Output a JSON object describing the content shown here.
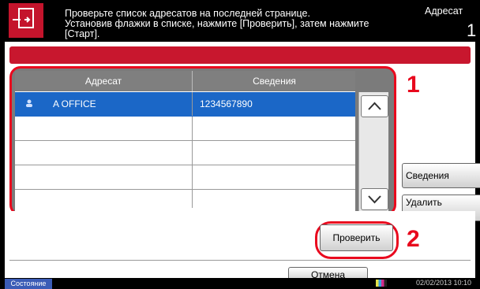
{
  "header": {
    "message_line1": "Проверьте список адресатов на последней странице.",
    "message_line2": "Установив флажки в списке, нажмите [Проверить], затем нажмите",
    "message_line3": "[Старт].",
    "dest_label": "Адресат",
    "dest_count": "1"
  },
  "table": {
    "col_dest": "Адресат",
    "col_info": "Сведения",
    "rows": [
      {
        "name": "A OFFICE",
        "detail": "1234567890"
      },
      {
        "name": "",
        "detail": ""
      },
      {
        "name": "",
        "detail": ""
      },
      {
        "name": "",
        "detail": ""
      },
      {
        "name": "",
        "detail": ""
      }
    ]
  },
  "buttons": {
    "details": "Сведения",
    "delete": "Удалить",
    "check": "Проверить",
    "cancel": "Отмена"
  },
  "callouts": {
    "one": "1",
    "two": "2"
  },
  "footer": {
    "status": "Состояние",
    "datetime": "02/02/2013  10:10"
  },
  "colors": {
    "accent": "#c8172e",
    "selection": "#1b67c7",
    "callout": "#e8081d"
  }
}
